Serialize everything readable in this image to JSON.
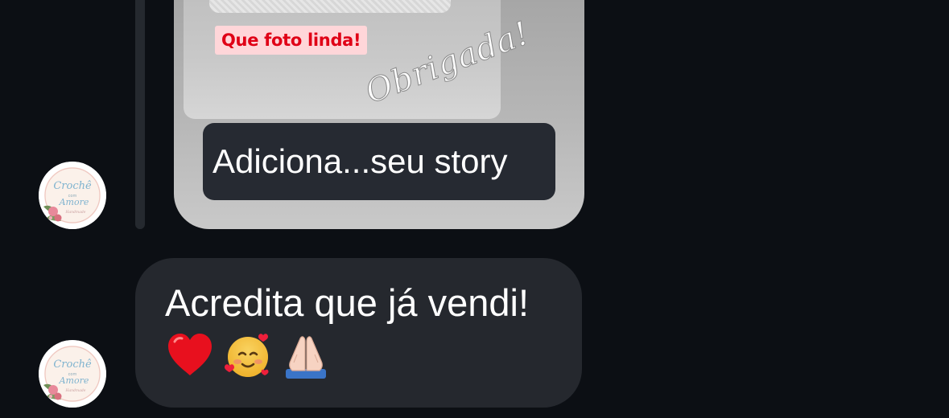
{
  "chat": {
    "story_reply": {
      "tag_text": "Que foto linda!",
      "script_text": "Obrigada!",
      "label": "Adiciona...seu story"
    },
    "message": {
      "text": "Acredita que já vendi!",
      "emojis": [
        "red-heart",
        "smiling-face-with-hearts",
        "folded-hands"
      ]
    },
    "avatar": {
      "logo_line1": "Crochê",
      "logo_line2": "com",
      "logo_line3": "Amore",
      "logo_line4": "Handmade"
    }
  },
  "colors": {
    "background": "#0c0f14",
    "bubble": "#25282e",
    "label_bg": "#262a32",
    "tag_bg": "#ffd6d9",
    "tag_text": "#e00016"
  }
}
